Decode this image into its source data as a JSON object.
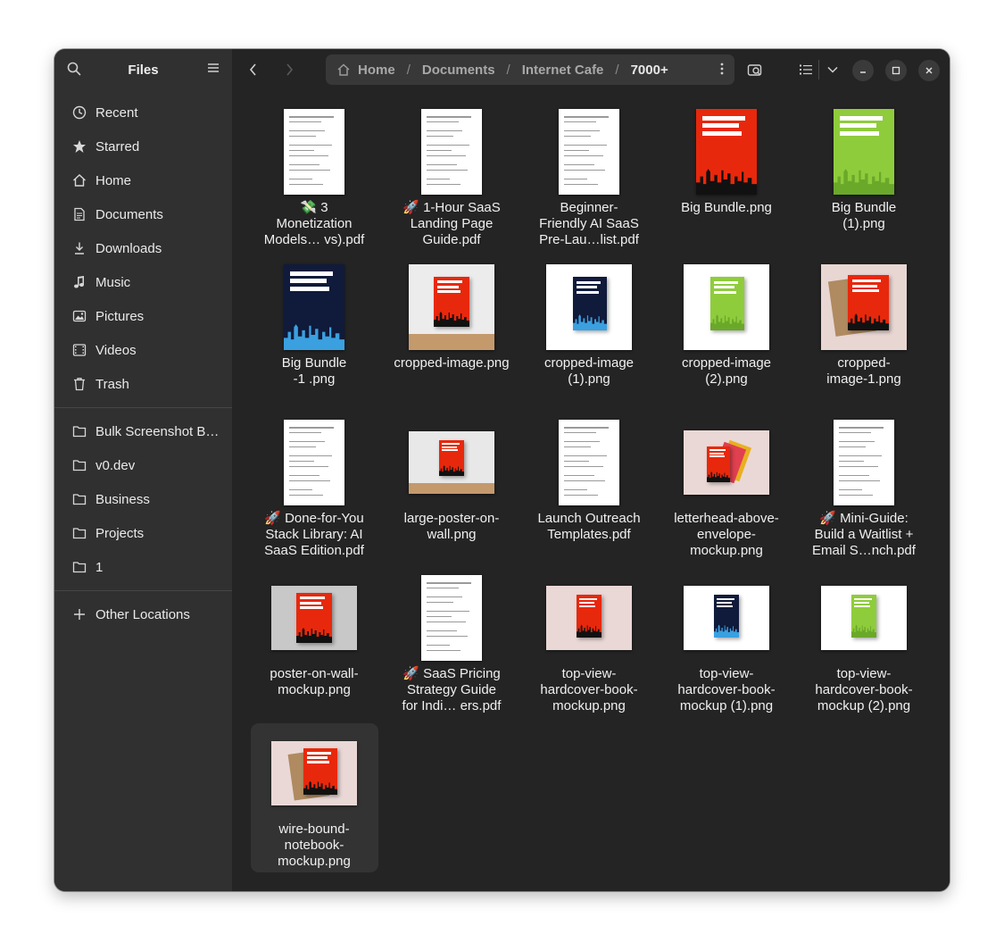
{
  "sidebar": {
    "title": "Files",
    "places": [
      {
        "label": "Recent",
        "icon": "clock-icon"
      },
      {
        "label": "Starred",
        "icon": "star-icon"
      },
      {
        "label": "Home",
        "icon": "home-icon"
      },
      {
        "label": "Documents",
        "icon": "document-icon"
      },
      {
        "label": "Downloads",
        "icon": "download-icon"
      },
      {
        "label": "Music",
        "icon": "music-icon"
      },
      {
        "label": "Pictures",
        "icon": "picture-icon"
      },
      {
        "label": "Videos",
        "icon": "video-icon"
      },
      {
        "label": "Trash",
        "icon": "trash-icon"
      }
    ],
    "bookmarks": [
      {
        "label": "Bulk Screenshot B…",
        "icon": "folder-icon"
      },
      {
        "label": "v0.dev",
        "icon": "folder-icon"
      },
      {
        "label": "Business",
        "icon": "folder-icon"
      },
      {
        "label": "Projects",
        "icon": "folder-icon"
      },
      {
        "label": "1",
        "icon": "folder-icon"
      }
    ],
    "other_locations": "Other Locations"
  },
  "pathbar": {
    "crumbs": [
      "Home",
      "Documents",
      "Internet Cafe",
      "7000+"
    ]
  },
  "files": [
    {
      "lines": [
        "💸 3",
        "Monetization",
        "Models… vs).pdf"
      ],
      "kind": "doc"
    },
    {
      "lines": [
        "🚀 1-Hour SaaS",
        "Landing Page",
        "Guide.pdf"
      ],
      "kind": "doc"
    },
    {
      "lines": [
        "Beginner-",
        "Friendly AI SaaS",
        "Pre-Lau…list.pdf"
      ],
      "kind": "doc"
    },
    {
      "lines": [
        "Big Bundle.png"
      ],
      "kind": "cover-red"
    },
    {
      "lines": [
        "Big Bundle",
        "(1).png"
      ],
      "kind": "cover-green"
    },
    {
      "lines": [
        "Big Bundle",
        "-1 .png"
      ],
      "kind": "cover-navy"
    },
    {
      "lines": [
        "cropped-image.png"
      ],
      "kind": "poster-wall"
    },
    {
      "lines": [
        "cropped-image",
        "(1).png"
      ],
      "kind": "book-navy"
    },
    {
      "lines": [
        "cropped-image",
        "(2).png"
      ],
      "kind": "book-green"
    },
    {
      "lines": [
        "cropped-",
        "image-1.png"
      ],
      "kind": "notebook-square"
    },
    {
      "lines": [
        "🚀 Done-for-You",
        "Stack Library: AI",
        "SaaS Edition.pdf"
      ],
      "kind": "doc"
    },
    {
      "lines": [
        "large-poster-on-",
        "wall.png"
      ],
      "kind": "poster-wide"
    },
    {
      "lines": [
        "Launch Outreach",
        "Templates.pdf"
      ],
      "kind": "doc"
    },
    {
      "lines": [
        "letterhead-above-",
        "envelope-",
        "mockup.png"
      ],
      "kind": "letterhead"
    },
    {
      "lines": [
        "🚀 Mini-Guide:",
        "Build a Waitlist +",
        "Email S…nch.pdf"
      ],
      "kind": "doc"
    },
    {
      "lines": [
        "poster-on-wall-",
        "mockup.png"
      ],
      "kind": "poster-gray"
    },
    {
      "lines": [
        "🚀 SaaS Pricing",
        "Strategy Guide",
        "for Indi… ers.pdf"
      ],
      "kind": "doc"
    },
    {
      "lines": [
        "top-view-",
        "hardcover-book-",
        "mockup.png"
      ],
      "kind": "topview-red"
    },
    {
      "lines": [
        "top-view-",
        "hardcover-book-",
        "mockup (1).png"
      ],
      "kind": "topview-navy"
    },
    {
      "lines": [
        "top-view-",
        "hardcover-book-",
        "mockup (2).png"
      ],
      "kind": "topview-green"
    },
    {
      "lines": [
        "wire-bound-",
        "notebook-",
        "mockup.png"
      ],
      "kind": "notebook-wide",
      "selected": true
    }
  ],
  "colors": {
    "window_bg": "#242424",
    "sidebar_bg": "#303030",
    "cover_red": "#e8280c",
    "cover_green": "#8fcc3c",
    "cover_navy": "#101a3a",
    "cover_cyan": "#3aa0e0"
  }
}
